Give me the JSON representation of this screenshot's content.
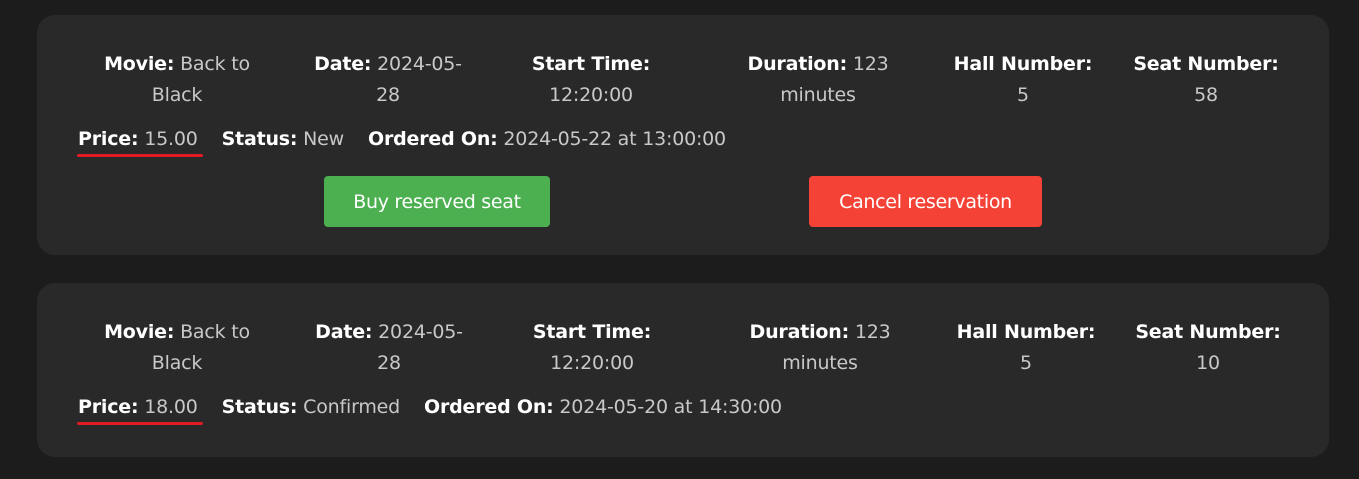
{
  "labels": {
    "movie": "Movie:",
    "date": "Date:",
    "start_time": "Start Time:",
    "duration": "Duration:",
    "hall_number": "Hall Number:",
    "seat_number": "Seat Number:",
    "price": "Price:",
    "status": "Status:",
    "ordered_on": "Ordered On:"
  },
  "reservations": [
    {
      "movie_line1": "Back to",
      "movie_line2": "Black",
      "date_line1": "2024-05-",
      "date_line2": "28",
      "start_time": "12:20:00",
      "duration_line1": "123",
      "duration_line2": "minutes",
      "hall_number": "5",
      "seat_number": "58",
      "price": "15.00",
      "status": "New",
      "ordered_on": "2024-05-22 at 13:00:00",
      "buy_label": "Buy reserved seat",
      "cancel_label": "Cancel reservation"
    },
    {
      "movie_line1": "Back to",
      "movie_line2": "Black",
      "date_line1": "2024-05-",
      "date_line2": "28",
      "start_time": "12:20:00",
      "duration_line1": "123",
      "duration_line2": "minutes",
      "hall_number": "5",
      "seat_number": "10",
      "price": "18.00",
      "status": "Confirmed",
      "ordered_on": "2024-05-20 at 14:30:00"
    }
  ],
  "colors": {
    "page_background": "#1c1c1c",
    "card_background": "#292929",
    "buy_button": "#4caf50",
    "cancel_button": "#f44336",
    "price_underline": "#e11b22"
  }
}
